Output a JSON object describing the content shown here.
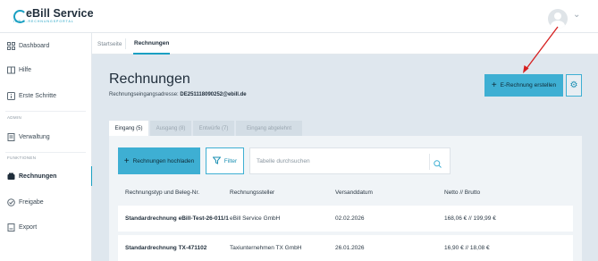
{
  "header": {
    "logo_text": "eBill Service",
    "logo_sub": "IHR E-RECHNUNGSPORTAL"
  },
  "sidebar": {
    "items": [
      {
        "label": "Dashboard",
        "icon": "dashboard-icon"
      },
      {
        "label": "Hilfe",
        "icon": "book-icon"
      },
      {
        "label": "Erste Schritte",
        "icon": "info-icon"
      },
      {
        "label": "Verwaltung",
        "icon": "document-icon"
      },
      {
        "label": "Rechnungen",
        "icon": "invoice-icon"
      },
      {
        "label": "Freigabe",
        "icon": "approval-icon"
      },
      {
        "label": "Export",
        "icon": "export-icon"
      }
    ],
    "section_admin": "ADMIN",
    "section_functions": "FUNKTIONEN"
  },
  "breadcrumb": {
    "home": "Startseite",
    "current": "Rechnungen"
  },
  "page": {
    "title": "Rechnungen",
    "address_label": "Rechnungseingangsadresse:",
    "address_value": "DE251118090252@ebill.de",
    "create_button": "E-Rechnung erstellen"
  },
  "filter_tabs": [
    {
      "label": "Eingang (5)",
      "active": true
    },
    {
      "label": "Ausgang (8)",
      "active": false
    },
    {
      "label": "Entwürfe (7)",
      "active": false
    },
    {
      "label": "Eingang abgelehnt",
      "active": false
    }
  ],
  "toolbar": {
    "upload_button": "Rechnungen hochladen",
    "filter_button": "Filter",
    "search_placeholder": "Tabelle durchsuchen"
  },
  "table": {
    "columns": [
      "Rechnungstyp und Beleg-Nr.",
      "Rechnungssteller",
      "Versanddatum",
      "Netto // Brutto"
    ],
    "rows": [
      {
        "type": "Standardrechnung eBill-Test-26-011/1",
        "issuer": "eBill Service GmbH",
        "date": "02.02.2026",
        "amount": "168,06 € // 199,99 €"
      },
      {
        "type": "Standardrechnung TX-471102",
        "issuer": "Taxiunternehmen TX GmbH",
        "date": "26.01.2026",
        "amount": "16,90 € // 18,08 €"
      }
    ]
  },
  "colors": {
    "accent": "#3eafd3",
    "main_bg": "#dfe7ee",
    "annotation_arrow": "#d62020"
  }
}
